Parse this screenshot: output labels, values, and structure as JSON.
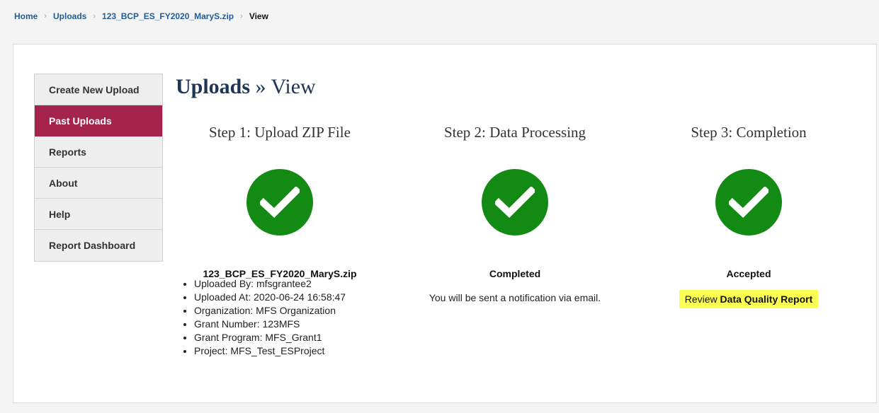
{
  "breadcrumb": {
    "home": "Home",
    "uploads": "Uploads",
    "file": "123_BCP_ES_FY2020_MaryS.zip",
    "current": "View",
    "separator": "›"
  },
  "sidebar": {
    "items": [
      {
        "label": "Create New Upload"
      },
      {
        "label": "Past Uploads"
      },
      {
        "label": "Reports"
      },
      {
        "label": "About"
      },
      {
        "label": "Help"
      },
      {
        "label": "Report Dashboard"
      }
    ]
  },
  "title": {
    "main": "Uploads",
    "rest": " » View"
  },
  "steps": [
    {
      "title": "Step 1: Upload ZIP File",
      "status": "123_BCP_ES_FY2020_MaryS.zip",
      "details": [
        "Uploaded By: mfsgrantee2",
        "Uploaded At: 2020-06-24 16:58:47",
        "Organization: MFS Organization",
        "Grant Number: 123MFS",
        "Grant Program: MFS_Grant1",
        "Project: MFS_Test_ESProject"
      ]
    },
    {
      "title": "Step 2: Data Processing",
      "status": "Completed",
      "message": "You will be sent a notification via email."
    },
    {
      "title": "Step 3: Completion",
      "status": "Accepted",
      "review_prefix": "Review ",
      "review_link": "Data Quality Report"
    }
  ],
  "icons": {
    "check": "checkmark-circle-icon"
  },
  "colors": {
    "accent": "#a4244d",
    "success": "#138a13",
    "link": "#1f5c99",
    "highlight": "#fbff52",
    "title": "#1e3556"
  }
}
